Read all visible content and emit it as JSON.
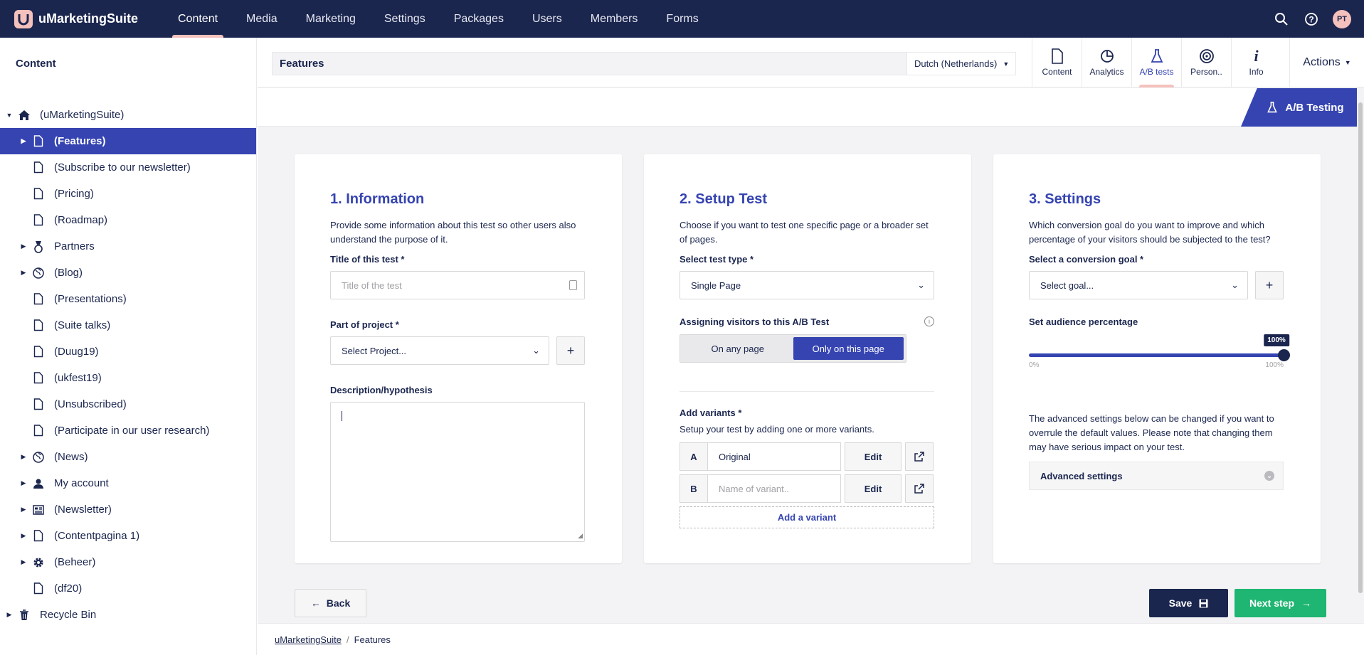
{
  "brand": {
    "name": "uMarketingSuite"
  },
  "nav": {
    "items": [
      "Content",
      "Media",
      "Marketing",
      "Settings",
      "Packages",
      "Users",
      "Members",
      "Forms"
    ],
    "active": "Content"
  },
  "user": {
    "initials": "PT"
  },
  "sidebar": {
    "title": "Content",
    "items": [
      {
        "label": "(uMarketingSuite)",
        "icon": "home-icon",
        "caret": "down",
        "level": 0
      },
      {
        "label": "(Features)",
        "icon": "document-icon",
        "caret": "right",
        "level": 1,
        "selected": true
      },
      {
        "label": "(Subscribe to our newsletter)",
        "icon": "document-icon",
        "caret": "",
        "level": 1
      },
      {
        "label": "(Pricing)",
        "icon": "document-icon",
        "caret": "",
        "level": 1
      },
      {
        "label": "(Roadmap)",
        "icon": "document-icon",
        "caret": "",
        "level": 1
      },
      {
        "label": "Partners",
        "icon": "medal-icon",
        "caret": "right",
        "level": 1
      },
      {
        "label": "(Blog)",
        "icon": "globe-icon",
        "caret": "right",
        "level": 1
      },
      {
        "label": "(Presentations)",
        "icon": "document-icon",
        "caret": "",
        "level": 1
      },
      {
        "label": "(Suite talks)",
        "icon": "document-icon",
        "caret": "",
        "level": 1
      },
      {
        "label": "(Duug19)",
        "icon": "document-icon",
        "caret": "",
        "level": 1
      },
      {
        "label": "(ukfest19)",
        "icon": "document-icon",
        "caret": "",
        "level": 1
      },
      {
        "label": "(Unsubscribed)",
        "icon": "document-icon",
        "caret": "",
        "level": 1
      },
      {
        "label": "(Participate in our user research)",
        "icon": "document-icon",
        "caret": "",
        "level": 1
      },
      {
        "label": "(News)",
        "icon": "globe-icon",
        "caret": "right",
        "level": 1
      },
      {
        "label": "My account",
        "icon": "user-icon",
        "caret": "right",
        "level": 1
      },
      {
        "label": "(Newsletter)",
        "icon": "newspaper-icon",
        "caret": "right",
        "level": 1
      },
      {
        "label": "(Contentpagina 1)",
        "icon": "document-icon",
        "caret": "right",
        "level": 1
      },
      {
        "label": "(Beheer)",
        "icon": "gear-icon",
        "caret": "right",
        "level": 1
      },
      {
        "label": "(df20)",
        "icon": "document-icon",
        "caret": "",
        "level": 1
      },
      {
        "label": "Recycle Bin",
        "icon": "trash-icon",
        "caret": "right",
        "level": 0
      }
    ]
  },
  "editor": {
    "node_name": "Features",
    "culture": "Dutch (Netherlands)",
    "apps": [
      {
        "label": "Content",
        "icon": "document-icon"
      },
      {
        "label": "Analytics",
        "icon": "pie-chart-icon"
      },
      {
        "label": "A/B tests",
        "icon": "flask-icon",
        "active": true
      },
      {
        "label": "Person..",
        "icon": "target-icon"
      },
      {
        "label": "Info",
        "icon": "info-icon"
      }
    ],
    "actions_label": "Actions",
    "subtab": "A/B Testing"
  },
  "step1": {
    "title": "1. Information",
    "desc": "Provide some information about this test so other users also understand the purpose of it.",
    "title_label": "Title of this test *",
    "title_placeholder": "Title of the test",
    "project_label": "Part of project *",
    "project_value": "Select Project...",
    "description_label": "Description/hypothesis"
  },
  "step2": {
    "title": "2. Setup Test",
    "desc": "Choose if you want to test one specific page or a broader set of pages.",
    "type_label": "Select test type *",
    "type_value": "Single Page",
    "assign_label": "Assigning visitors to this A/B Test",
    "assign_options": [
      "On any page",
      "Only on this page"
    ],
    "assign_selected": "Only on this page",
    "variants_label": "Add variants *",
    "variants_desc": "Setup your test by adding one or more variants.",
    "variants": [
      {
        "letter": "A",
        "name": "Original",
        "placeholder": ""
      },
      {
        "letter": "B",
        "name": "",
        "placeholder": "Name of variant.."
      }
    ],
    "edit_label": "Edit",
    "add_variant_label": "Add a variant"
  },
  "step3": {
    "title": "3. Settings",
    "desc": "Which conversion goal do you want to improve and which percentage of your visitors should be subjected to the test?",
    "goal_label": "Select a conversion goal *",
    "goal_value": "Select goal...",
    "audience_label": "Set audience percentage",
    "audience_value": "100%",
    "audience_level": 1.0,
    "slider_min": "0%",
    "slider_max": "100%",
    "advanced_desc": "The advanced settings below can be changed if you want to overrule the default values. Please note that changing them may have serious impact on your test.",
    "advanced_label": "Advanced settings"
  },
  "buttons": {
    "back": "Back",
    "save": "Save",
    "next": "Next step"
  },
  "breadcrumb": [
    "uMarketingSuite",
    "Features"
  ],
  "colors": {
    "navy": "#1b264f",
    "blue": "#3544b1",
    "green": "#1fb572",
    "pink": "#f5c1bc"
  }
}
